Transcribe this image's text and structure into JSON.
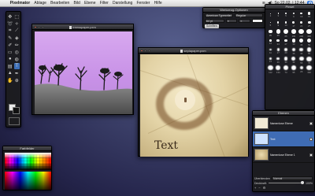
{
  "menubar": {
    "apple_glyph": "",
    "app_name": "Pixelmator",
    "items": [
      "Ablage",
      "Bearbeiten",
      "Bild",
      "Ebene",
      "Filter",
      "Darstellung",
      "Fenster",
      "Hilfe"
    ],
    "clock": "So 22.02. | 12:44"
  },
  "windows": {
    "trees": {
      "title": "treesspaper.pxm"
    },
    "paper": {
      "title": "sepiapaper.pxm",
      "canvas_text": "Text"
    }
  },
  "panels": {
    "colors": {
      "title": "Farbfelder"
    },
    "options": {
      "title": "Werkzeug-Optionen",
      "font_family": "American Typewriter",
      "font_style": "Regular",
      "size": "64 pt",
      "button": "Schriften"
    },
    "brushes": {
      "title": "Pinsel",
      "sizes": [
        1,
        3,
        5,
        9,
        13,
        19,
        5,
        9,
        13,
        17,
        21,
        27,
        35,
        45,
        65,
        100,
        200,
        300,
        14,
        24,
        27,
        39,
        46,
        59,
        11,
        17,
        23,
        36,
        44,
        60,
        14,
        26,
        33,
        42,
        55,
        70,
        112,
        134,
        74,
        95,
        29,
        192
      ]
    },
    "layers": {
      "title": "Ebenen",
      "items": [
        {
          "name": "Namenlose Ebene"
        },
        {
          "name": "Text"
        },
        {
          "name": "Namenlose Ebene 1"
        }
      ],
      "blend_label": "Überblenden",
      "blend_value": "Normal",
      "opacity_label": "Deckkraft:",
      "opacity_value": "100%",
      "opacity": 1.0
    }
  },
  "colors": {
    "accent": "#3d6fb8",
    "trees_sky_top": "#d7a8ef",
    "trees_ground": "#7e7e7e"
  }
}
